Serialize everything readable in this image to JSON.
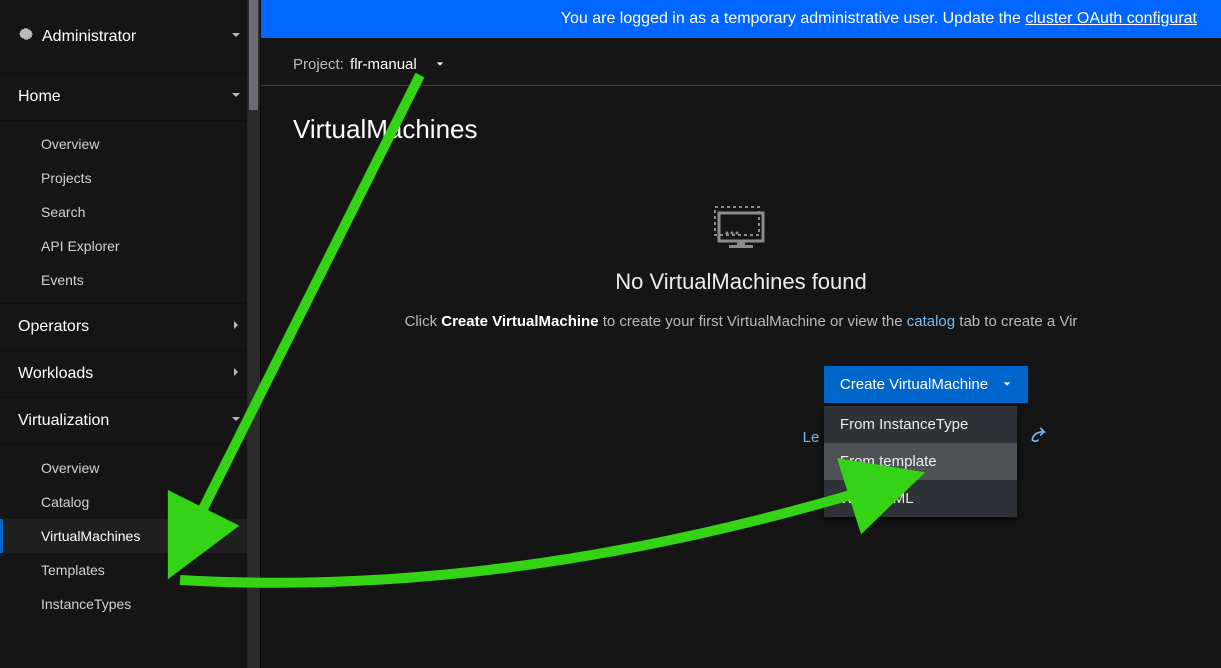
{
  "banner": {
    "prefix": "You are logged in as a temporary administrative user. Update the ",
    "link": "cluster OAuth configurat"
  },
  "sidebar": {
    "admin_label": "Administrator",
    "sections": {
      "home": "Home",
      "operators": "Operators",
      "workloads": "Workloads",
      "virtualization": "Virtualization"
    },
    "home_items": [
      "Overview",
      "Projects",
      "Search",
      "API Explorer",
      "Events"
    ],
    "virt_items": [
      "Overview",
      "Catalog",
      "VirtualMachines",
      "Templates",
      "InstanceTypes"
    ]
  },
  "project": {
    "prefix": "Project:",
    "name": "flr-manual"
  },
  "page": {
    "title": "VirtualMachines"
  },
  "empty": {
    "title": "No VirtualMachines found",
    "sub_click": "Click ",
    "sub_bold": "Create VirtualMachine",
    "sub_rest": " to create your first VirtualMachine or view the ",
    "sub_link": "catalog",
    "sub_tail": " tab to create a Vir"
  },
  "create": {
    "button": "Create VirtualMachine",
    "items": [
      "From InstanceType",
      "From template",
      "With YAML"
    ]
  },
  "learn_trunc": "Le"
}
